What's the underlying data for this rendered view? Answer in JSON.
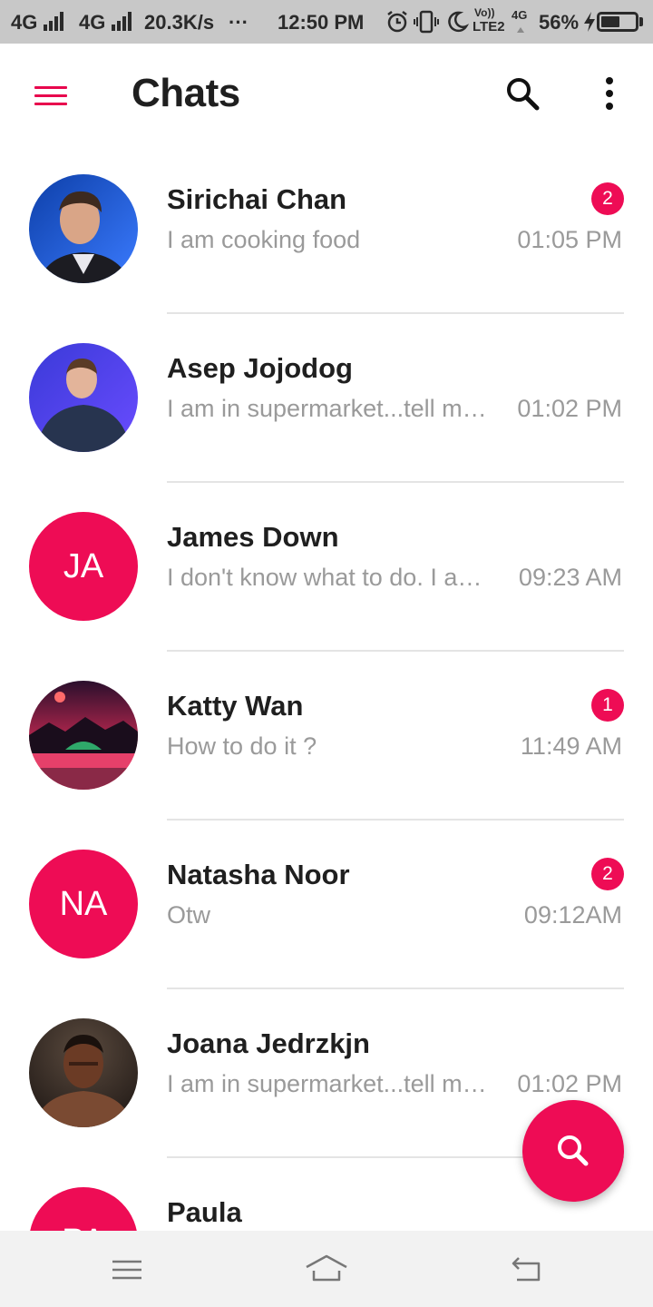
{
  "status_bar": {
    "network_1": "4G",
    "network_2": "4G",
    "speed": "20.3K/s",
    "more": "···",
    "time": "12:50 PM",
    "volte_top": "Vo))",
    "volte_bottom": "LTE2",
    "net_small": "4G",
    "battery_percent": "56%",
    "battery_level": 0.56
  },
  "app_bar": {
    "title": "Chats",
    "menu_icon": "hamburger-menu-icon",
    "search_icon": "search-icon",
    "more_icon": "more-vertical-icon"
  },
  "chats": [
    {
      "name": "Sirichai Chan",
      "preview": "I am cooking food",
      "time": "01:05 PM",
      "badge": "2",
      "avatar": "photo"
    },
    {
      "name": "Asep Jojodog",
      "preview": "I am in supermarket...tell me what to buy",
      "time": "01:02 PM",
      "badge": "",
      "avatar": "photo"
    },
    {
      "name": "James Down",
      "preview": "I don't know what to do. I am confused",
      "time": "09:23 AM",
      "badge": "",
      "avatar": "initials",
      "initials": "JA"
    },
    {
      "name": "Katty Wan",
      "preview": "How to do it ?",
      "time": "11:49 AM",
      "badge": "1",
      "avatar": "photo"
    },
    {
      "name": "Natasha Noor",
      "preview": "Otw",
      "time": "09:12AM",
      "badge": "2",
      "avatar": "initials",
      "initials": "NA"
    },
    {
      "name": "Joana Jedrzkjn",
      "preview": "I am in supermarket...tell me what to buy",
      "time": "01:02 PM",
      "badge": "",
      "avatar": "photo"
    },
    {
      "name": "Paula",
      "preview": "",
      "time": "",
      "badge": "",
      "avatar": "initials",
      "initials": "PA"
    }
  ],
  "fab": {
    "icon": "search-icon"
  },
  "nav_bar": {
    "menu_icon": "menu-icon",
    "home_icon": "home-icon",
    "back_icon": "back-icon"
  },
  "colors": {
    "accent": "#ee0c55",
    "divider": "#e4e4e4",
    "muted_text": "#9a9a9a"
  }
}
